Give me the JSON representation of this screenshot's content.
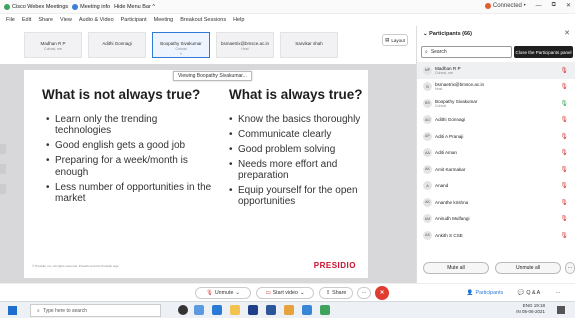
{
  "window": {
    "tab_app": "Cisco Webex Meetings",
    "tab_info": "Meeting info",
    "tab_hide": "Hide Menu Bar ^",
    "connected": "Connected •",
    "minimize": "—",
    "restore": "⧉",
    "close": "✕"
  },
  "menu": [
    "File",
    "Edit",
    "Share",
    "View",
    "Audio & Video",
    "Participant",
    "Meeting",
    "Breakout Sessions",
    "Help"
  ],
  "thumbnails": [
    {
      "name": "Madhan R P",
      "sub": "Cohost, me"
    },
    {
      "name": "Adithi Gonnagi",
      "sub": ""
    },
    {
      "name": "Boopathy Sivakumar",
      "sub": "Cohost"
    },
    {
      "name": "bsmaetrix@bmsce.ac.in",
      "sub": "Host"
    },
    {
      "name": "Sarvikar shah",
      "sub": ""
    }
  ],
  "layout_label": "Layout",
  "tooltip": "Viewing Boopathy Sivakumar...",
  "slide": {
    "left_heading": "What is not always true?",
    "right_heading": "What is always true?",
    "left_bullets": [
      "Learn only the trending technologies",
      "Good english gets a good job",
      "Preparing for a week/month is enough",
      "Less number of opportunities in the market"
    ],
    "right_bullets": [
      "Know the basics thoroughly",
      "Communicate clearly",
      "Good problem solving",
      "Needs more effort and preparation",
      "Equip yourself for the open opportunities"
    ],
    "footer": "© Presidio, Inc. All rights reserved. Presidio and the Presidio logo",
    "brand": "PRESIDIO",
    "brand_color": "#c8102e"
  },
  "panel": {
    "title": "Participants (66)",
    "search_placeholder": "Search",
    "close_tip": "Close the Participants panel",
    "participants": [
      {
        "initials": "MP",
        "name": "Madhan R P",
        "role": "Cohost, me",
        "mic": "muted"
      },
      {
        "initials": "B",
        "name": "bsmaetrix@bmsce.ac.in",
        "role": "Host",
        "mic": "muted"
      },
      {
        "initials": "BS",
        "name": "Boopathy Sivakumar",
        "role": "Cohost",
        "mic": "on"
      },
      {
        "initials": "AG",
        "name": "Adithi Gonnagi",
        "role": "",
        "mic": "muted"
      },
      {
        "initials": "AP",
        "name": "Aditi A Pranaji",
        "role": "",
        "mic": "muted"
      },
      {
        "initials": "AA",
        "name": "Aditi Aman",
        "role": "",
        "mic": "muted"
      },
      {
        "initials": "AK",
        "name": "Amit Karmakar",
        "role": "",
        "mic": "muted"
      },
      {
        "initials": "A",
        "name": "Anand",
        "role": "",
        "mic": "muted"
      },
      {
        "initials": "AK",
        "name": "Ananthe krishna",
        "role": "",
        "mic": "muted"
      },
      {
        "initials": "AM",
        "name": "Anirudh Mulfangi",
        "role": "",
        "mic": "muted"
      },
      {
        "initials": "AS",
        "name": "Ankith S CSE",
        "role": "",
        "mic": "muted"
      }
    ],
    "mute_all": "Mute all",
    "unmute_all": "Unmute all",
    "more": "···"
  },
  "controls": {
    "unmute": "Unmute",
    "start_video": "Start video",
    "share": "Share",
    "more": "···",
    "end": "✕",
    "participants": "Participants",
    "chat": "Q & A",
    "more_right": "···"
  },
  "taskbar": {
    "search_placeholder": "Type here to search",
    "lang": "ENG",
    "region": "IN",
    "time": "19:18",
    "date": "05-06-2021"
  }
}
